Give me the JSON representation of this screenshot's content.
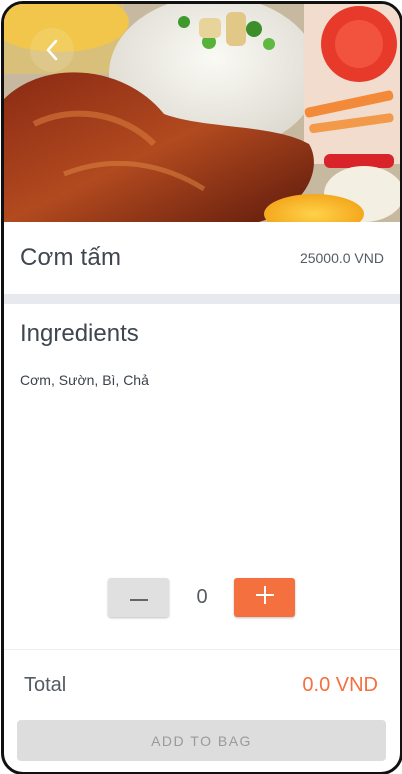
{
  "dish": {
    "name": "Cơm tấm",
    "price": "25000.0 VND"
  },
  "ingredients": {
    "title": "Ingredients",
    "list": "Cơm, Sườn, Bì, Chả"
  },
  "quantity": {
    "value": "0"
  },
  "total": {
    "label": "Total",
    "value": "0.0 VND"
  },
  "actions": {
    "add_to_bag": "ADD TO BAG"
  },
  "colors": {
    "accent": "#f4703e",
    "disabled_button": "#dddddd",
    "divider": "#e8e9ee"
  },
  "icons": {
    "back": "chevron-left-icon",
    "minus": "minus-icon",
    "plus": "plus-icon"
  }
}
